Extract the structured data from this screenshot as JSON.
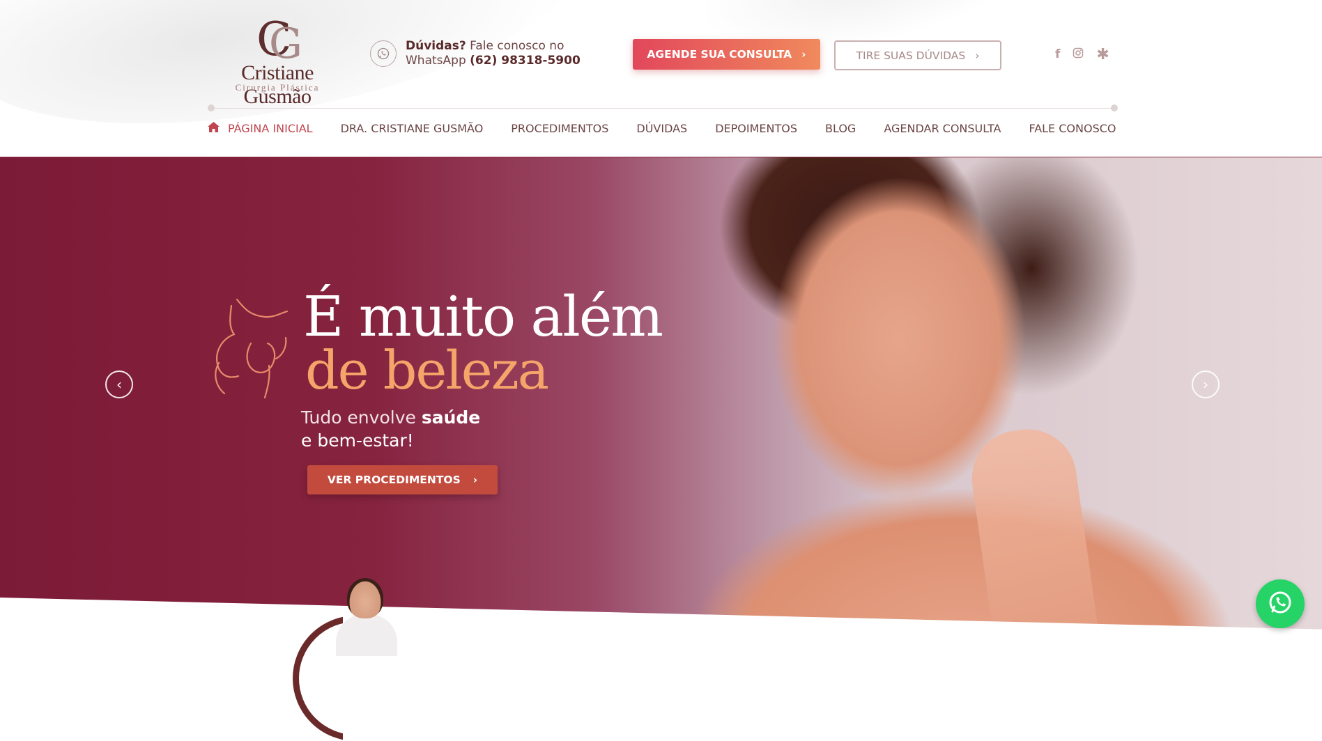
{
  "brand": {
    "name": "Cristiane Gusmão",
    "subtitle": "Cirurgia Plástica",
    "monogram": "CG"
  },
  "contact": {
    "question": "Dúvidas?",
    "text": "Fale conosco no",
    "channel": "WhatsApp",
    "phone": "(62) 98318-5900"
  },
  "header": {
    "cta_primary": "AGENDE SUA CONSULTA",
    "cta_secondary": "TIRE SUAS DÚVIDAS",
    "social": [
      "facebook-icon",
      "instagram-icon",
      "doctoralia-icon"
    ]
  },
  "nav": {
    "items": [
      {
        "label": "PÁGINA INICIAL",
        "active": true
      },
      {
        "label": "DRA. CRISTIANE GUSMÃO"
      },
      {
        "label": "PROCEDIMENTOS"
      },
      {
        "label": "DÚVIDAS"
      },
      {
        "label": "DEPOIMENTOS"
      },
      {
        "label": "BLOG"
      },
      {
        "label": "AGENDAR CONSULTA"
      },
      {
        "label": "FALE CONOSCO"
      }
    ]
  },
  "hero": {
    "title_line1": "É muito além",
    "title_line2": "de beleza",
    "subtitle_prefix": "Tudo envolve ",
    "subtitle_bold": "saúde",
    "subtitle_line2": "e bem-estar!",
    "cta": "VER PROCEDIMENTOS"
  },
  "colors": {
    "accent": "#c0454e",
    "gradient_start": "#e2475b",
    "gradient_end": "#f08a5d",
    "hero_bg": "#7c1b37",
    "hero_highlight": "#f5a46a",
    "whatsapp": "#25d366"
  }
}
